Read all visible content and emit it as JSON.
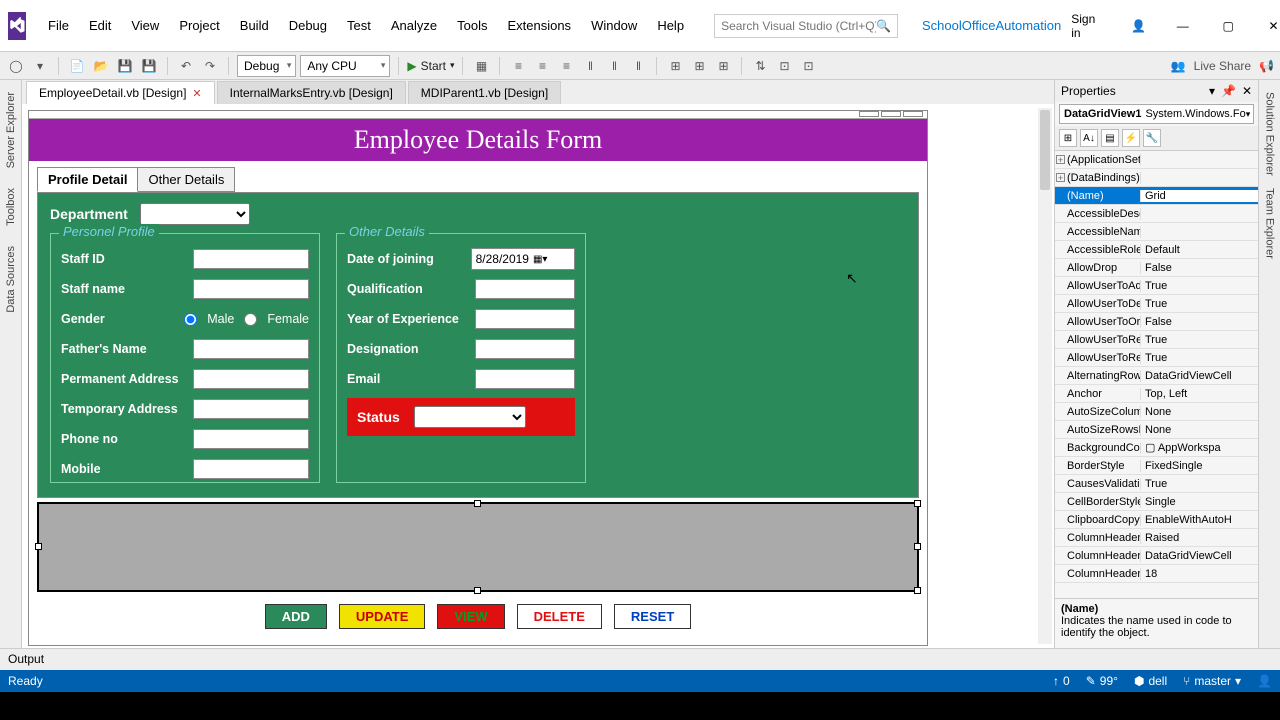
{
  "menu": {
    "file": "File",
    "edit": "Edit",
    "view": "View",
    "project": "Project",
    "build": "Build",
    "debug": "Debug",
    "test": "Test",
    "analyze": "Analyze",
    "tools": "Tools",
    "extensions": "Extensions",
    "window": "Window",
    "help": "Help"
  },
  "search_placeholder": "Search Visual Studio (Ctrl+Q)",
  "solution_name": "SchoolOfficeAutomation",
  "signin": "Sign in",
  "toolbar": {
    "config": "Debug",
    "cpu": "Any CPU",
    "start": "Start",
    "liveshare": "Live Share"
  },
  "tabs": {
    "a": "EmployeeDetail.vb [Design]",
    "b": "InternalMarksEntry.vb [Design]",
    "c": "MDIParent1.vb [Design]"
  },
  "leftrail": {
    "server": "Server Explorer",
    "toolbox": "Toolbox",
    "data": "Data Sources"
  },
  "rightrail": {
    "sol": "Solution Explorer",
    "team": "Team Explorer"
  },
  "form": {
    "title": "Employee Details Form",
    "tab_profile": "Profile Detail",
    "tab_other": "Other Details",
    "dept_label": "Department",
    "gb1_legend": "Personel Profile",
    "gb2_legend": "Other Details",
    "staff_id": "Staff ID",
    "staff_name": "Staff name",
    "gender": "Gender",
    "male": "Male",
    "female": "Female",
    "father": "Father's Name",
    "perm_addr": "Permanent Address",
    "temp_addr": "Temporary Address",
    "phone": "Phone no",
    "mobile": "Mobile",
    "doj": "Date of joining",
    "doj_val": "8/28/2019",
    "qual": "Qualification",
    "yoe": "Year of Experience",
    "desig": "Designation",
    "email": "Email",
    "status": "Status",
    "btn_add": "ADD",
    "btn_upd": "UPDATE",
    "btn_view": "VIEW",
    "btn_del": "DELETE",
    "btn_rst": "RESET"
  },
  "props": {
    "title": "Properties",
    "obj_name": "DataGridView1",
    "obj_type": "System.Windows.Fo",
    "rows": [
      {
        "k": "(ApplicationSet",
        "v": "",
        "exp": "+"
      },
      {
        "k": "(DataBindings)",
        "v": "",
        "exp": "+"
      },
      {
        "k": "(Name)",
        "v": "Grid",
        "sel": true
      },
      {
        "k": "AccessibleDesc",
        "v": ""
      },
      {
        "k": "AccessibleName",
        "v": ""
      },
      {
        "k": "AccessibleRole",
        "v": "Default"
      },
      {
        "k": "AllowDrop",
        "v": "False"
      },
      {
        "k": "AllowUserToAd",
        "v": "True"
      },
      {
        "k": "AllowUserToDe",
        "v": "True"
      },
      {
        "k": "AllowUserToOr",
        "v": "False"
      },
      {
        "k": "AllowUserToRe",
        "v": "True"
      },
      {
        "k": "AllowUserToRe",
        "v": "True"
      },
      {
        "k": "AlternatingRow",
        "v": "DataGridViewCell"
      },
      {
        "k": "Anchor",
        "v": "Top, Left"
      },
      {
        "k": "AutoSizeColum",
        "v": "None"
      },
      {
        "k": "AutoSizeRowsM",
        "v": "None"
      },
      {
        "k": "BackgroundCol",
        "v": "▢   AppWorkspa"
      },
      {
        "k": "BorderStyle",
        "v": "FixedSingle"
      },
      {
        "k": "CausesValidatio",
        "v": "True"
      },
      {
        "k": "CellBorderStyle",
        "v": "Single"
      },
      {
        "k": "ClipboardCopy",
        "v": "EnableWithAutoH"
      },
      {
        "k": "ColumnHeader",
        "v": "Raised"
      },
      {
        "k": "ColumnHeader",
        "v": "DataGridViewCell"
      },
      {
        "k": "ColumnHeader",
        "v": "18"
      }
    ],
    "desc_name": "(Name)",
    "desc_text": "Indicates the name used in code to identify the object."
  },
  "output": "Output",
  "status": {
    "ready": "Ready",
    "up": "0",
    "temp": "99°",
    "user": "dell",
    "branch": "master"
  }
}
